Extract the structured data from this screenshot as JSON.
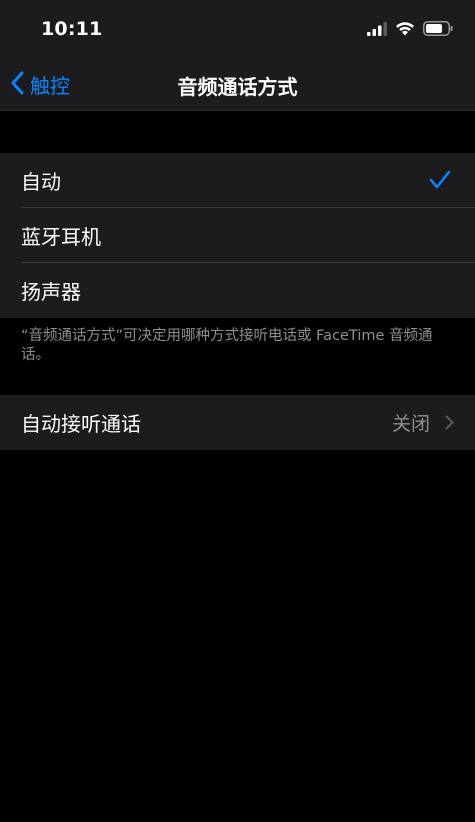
{
  "status": {
    "time": "10:11",
    "icons": [
      "cellular-signal-icon",
      "wifi-icon",
      "battery-icon"
    ]
  },
  "nav": {
    "back_label": "触控",
    "title": "音频通话方式"
  },
  "options": [
    {
      "label": "自动",
      "selected": true
    },
    {
      "label": "蓝牙耳机",
      "selected": false
    },
    {
      "label": "扬声器",
      "selected": false
    }
  ],
  "footer_note": "“音频通话方式”可决定用哪种方式接听电话或 FaceTime 音频通话。",
  "auto_answer": {
    "label": "自动接听通话",
    "value": "关闭"
  },
  "colors": {
    "accent": "#0a84ff",
    "background": "#000000",
    "cell": "#1c1c1e",
    "secondary_text": "#8e8e93"
  }
}
